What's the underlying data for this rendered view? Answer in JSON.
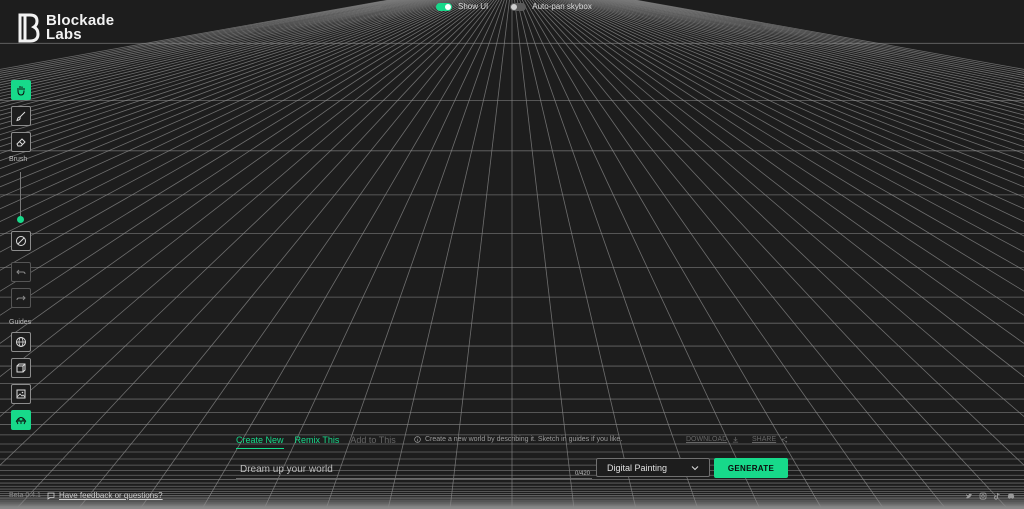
{
  "brand": {
    "line1": "Blockade",
    "line2": "Labs"
  },
  "topbar": {
    "show_ui_label": "Show UI",
    "show_ui_on": true,
    "autopan_label": "Auto-pan skybox",
    "autopan_on": false
  },
  "toolbar": {
    "brush_label": "Brush",
    "guides_label": "Guides",
    "brush_size_fraction": 0.98,
    "tools": [
      "hand-icon",
      "brush-icon",
      "eraser-icon",
      "clear-icon",
      "undo-icon",
      "redo-icon",
      "globe-guide-icon",
      "cube-guide-icon",
      "image-guide-icon",
      "dome-guide-icon"
    ]
  },
  "footer": {
    "beta": "Beta 0.4.1",
    "feedback": "Have feedback or questions?"
  },
  "tabs": [
    {
      "label": "Create New"
    },
    {
      "label": "Remix This"
    },
    {
      "label": "Add to This"
    }
  ],
  "hint": "Create a new world by describing it. Sketch in guides if you like.",
  "actions": {
    "download": "DOWNLOAD",
    "share": "SHARE"
  },
  "prompt": {
    "placeholder": "Dream up your world",
    "counter": "0/420"
  },
  "style": {
    "selected": "Digital Painting"
  },
  "generate_label": "GENERATE",
  "colors": {
    "accent": "#17d98a",
    "background": "#1d1d1d",
    "grid": "#8a8a8a"
  }
}
